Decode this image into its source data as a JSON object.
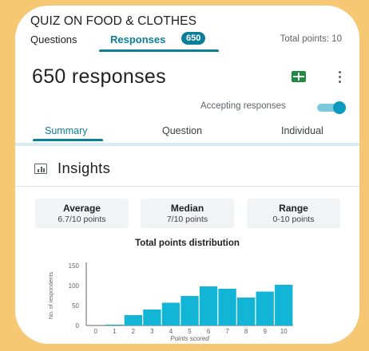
{
  "header": {
    "title": "QUIZ ON FOOD & CLOTHES",
    "tabs": {
      "questions": "Questions",
      "responses": "Responses",
      "responses_count": "650"
    },
    "total_points": "Total points: 10"
  },
  "responses": {
    "count_label": "650 responses",
    "sheets_icon": "sheets-icon",
    "more_icon": "more-vert-icon",
    "accepting_label": "Accepting responses",
    "accepting_on": true,
    "subtabs": [
      "Summary",
      "Question",
      "Individual"
    ]
  },
  "insights": {
    "title": "Insights",
    "icon": "chart-icon",
    "stats": [
      {
        "label": "Average",
        "value": "6.7/10 points"
      },
      {
        "label": "Median",
        "value": "7/10 points"
      },
      {
        "label": "Range",
        "value": "0-10 points"
      }
    ]
  },
  "colors": {
    "accent": "#0b7e9a",
    "bar": "#12b5d6",
    "background": "#f7c873",
    "card": "#d7edf3"
  },
  "chart_data": {
    "type": "bar",
    "title": "Total points distribution",
    "xlabel": "Points scored",
    "ylabel": "No. of respondents",
    "categories": [
      "0",
      "1",
      "2",
      "3",
      "4",
      "5",
      "6",
      "7",
      "8",
      "9",
      "10"
    ],
    "values": [
      0,
      2,
      26,
      40,
      57,
      74,
      98,
      92,
      70,
      85,
      102
    ],
    "yticks": [
      0,
      50,
      100,
      150
    ],
    "ylim": [
      0,
      150
    ],
    "grid": false
  }
}
